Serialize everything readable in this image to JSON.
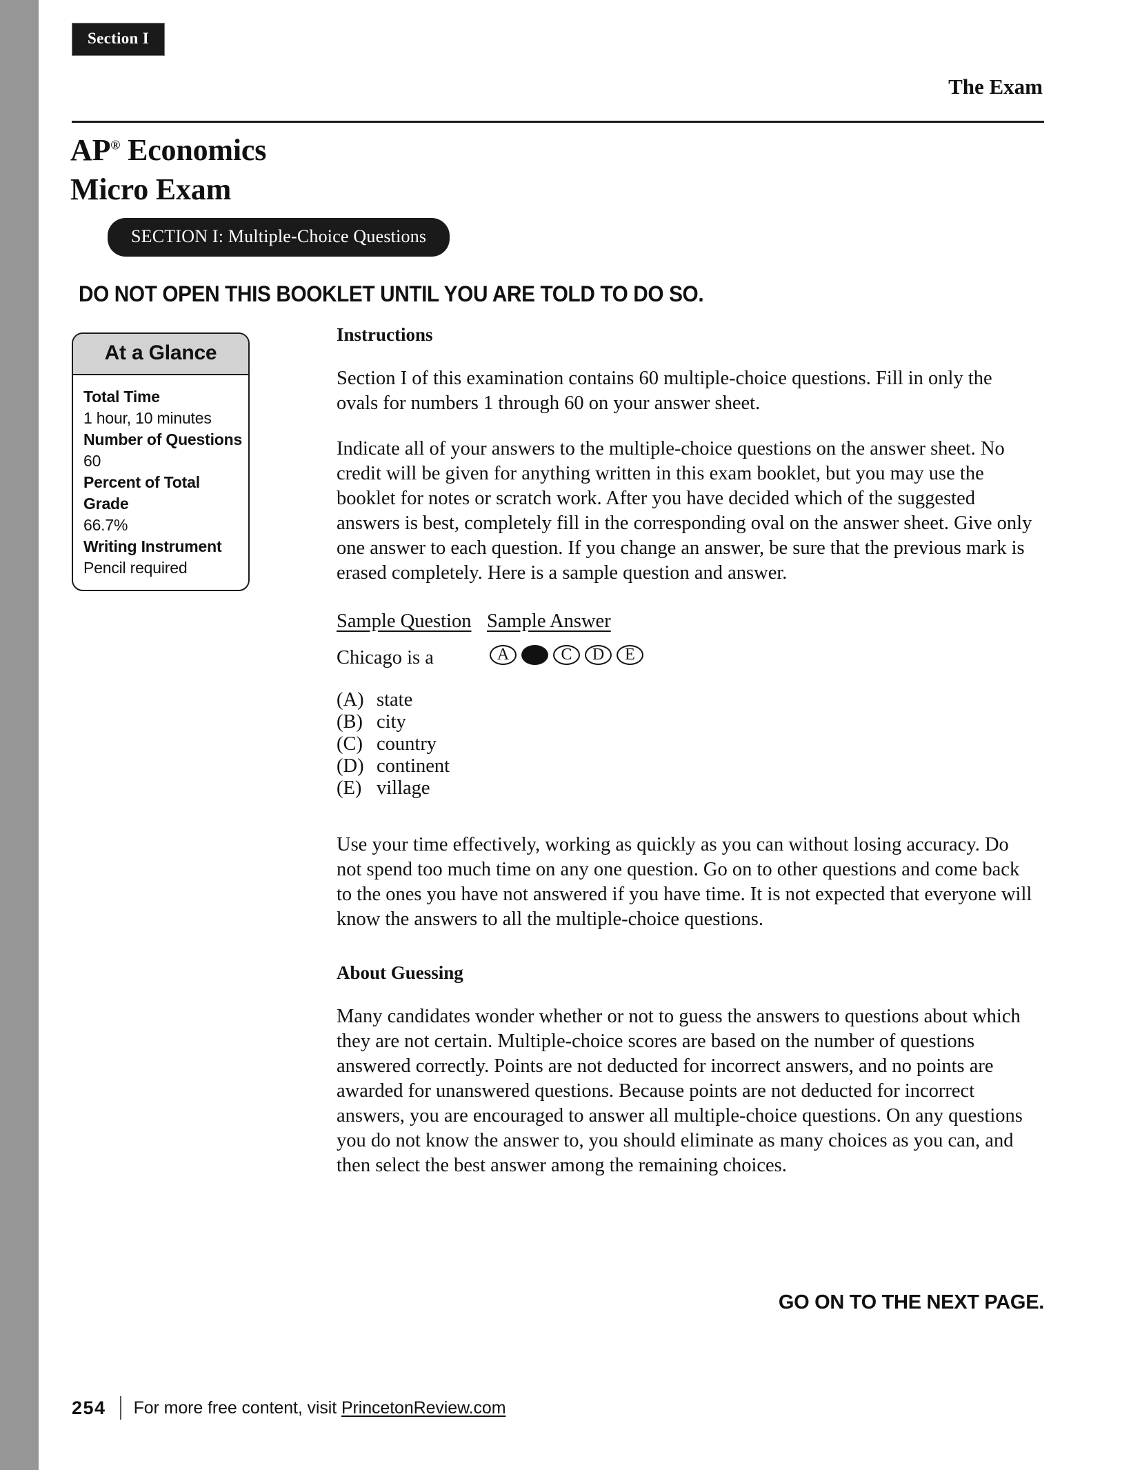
{
  "spine": {
    "color": "#969696"
  },
  "section_tab": {
    "label": "Section I"
  },
  "running_head": {
    "title": "The Exam"
  },
  "exam_title": {
    "line1_main": "AP",
    "line1_sup": "®",
    "line1_rest": " Economics",
    "line2": "Micro Exam"
  },
  "section_banner": {
    "label": "SECTION I: Multiple-Choice Questions"
  },
  "warning": {
    "text": "DO NOT OPEN THIS BOOKLET UNTIL YOU ARE TOLD TO DO SO."
  },
  "at_a_glance": {
    "header": "At a Glance",
    "rows": [
      {
        "term": "Total Time",
        "value": "1 hour, 10 minutes"
      },
      {
        "term": "Number of Questions",
        "value": "60"
      },
      {
        "term": "Percent of Total Grade",
        "value": "66.7%"
      },
      {
        "term": "Writing Instrument",
        "value": "Pencil required"
      }
    ]
  },
  "instructions": {
    "heading": "Instructions",
    "paragraph1": "Section I of this examination contains 60 multiple-choice questions. Fill in only the ovals for numbers 1 through 60 on your answer sheet.",
    "paragraph2": "Indicate all of your answers to the multiple-choice questions on the answer sheet. No credit will be given for anything written in this exam booklet, but you may use the booklet for notes or scratch work. After you have decided which of the suggested answers is best, completely fill in the corresponding oval on the answer sheet. Give only one answer to each question. If you change an answer, be sure that the previous mark is erased completely. Here is a sample question and answer.",
    "paragraph3": "Use your time effectively, working as quickly as you can without losing accuracy. Do not spend too much time on any one question. Go on to other questions and come back to the ones you have not answered if you have time. It is not expected that everyone will know the answers to all the multiple-choice questions."
  },
  "sample": {
    "question_label": "Sample Question",
    "answer_label": "Sample Answer",
    "question_text": "Chicago is a",
    "bubbles": [
      {
        "letter": "A",
        "filled": false
      },
      {
        "letter": "B",
        "filled": true
      },
      {
        "letter": "C",
        "filled": false
      },
      {
        "letter": "D",
        "filled": false
      },
      {
        "letter": "E",
        "filled": false
      }
    ],
    "choices": [
      {
        "letter": "(A)",
        "text": "state"
      },
      {
        "letter": "(B)",
        "text": "city"
      },
      {
        "letter": "(C)",
        "text": "country"
      },
      {
        "letter": "(D)",
        "text": "continent"
      },
      {
        "letter": "(E)",
        "text": "village"
      }
    ]
  },
  "about_guessing": {
    "heading": "About Guessing",
    "paragraph": "Many candidates wonder whether or not to guess the answers to questions about which they are not certain. Multiple-choice scores are based on the number of questions answered correctly. Points are not deducted for incorrect answers, and no points are awarded for unanswered questions. Because points are not deducted for incorrect answers, you are encouraged to answer all multiple-choice questions. On any questions you do not know the answer to, you should eliminate as many choices as you can, and then select the best answer among the remaining choices."
  },
  "next_page": {
    "text": "GO ON TO THE NEXT PAGE."
  },
  "footer": {
    "page_number": "254",
    "text_before": "For more free content, visit ",
    "link": "PrincetonReview.com"
  }
}
